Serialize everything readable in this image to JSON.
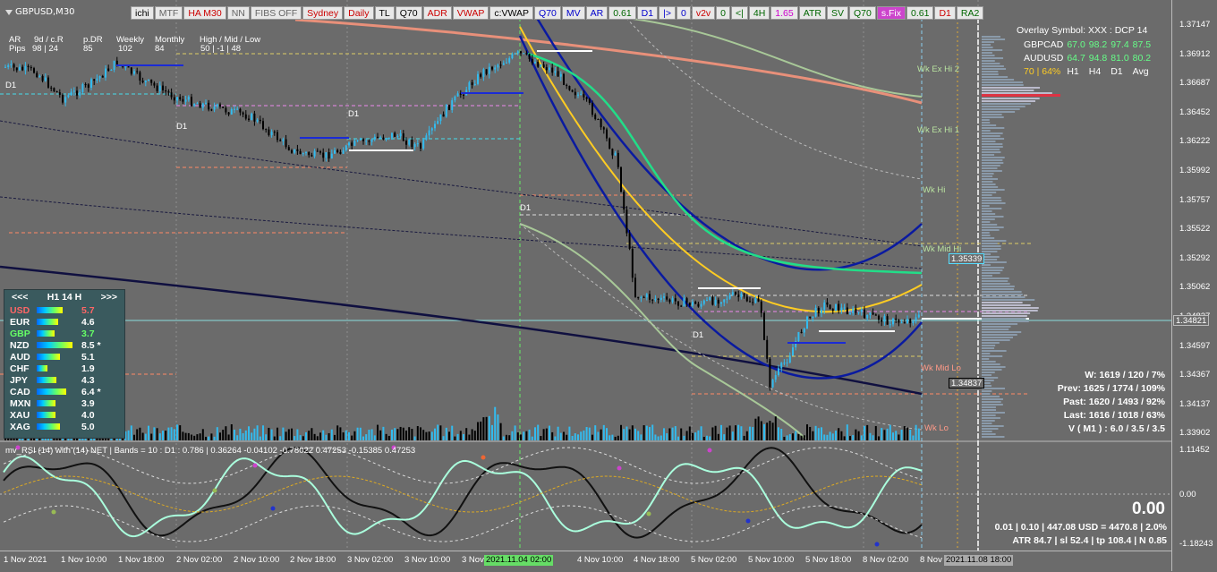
{
  "symbol": "GBPUSD,M30",
  "toolbar": [
    {
      "label": "ichi",
      "color": "#000000"
    },
    {
      "label": "MTF",
      "color": "#666666"
    },
    {
      "label": "HA M30",
      "color": "#cc0000"
    },
    {
      "label": "NN",
      "color": "#666666"
    },
    {
      "label": "FIBS OFF",
      "color": "#666666"
    },
    {
      "label": "Sydney",
      "color": "#cc0000"
    },
    {
      "label": "Daily",
      "color": "#cc0000"
    },
    {
      "label": "TL",
      "color": "#000000"
    },
    {
      "label": "Q70",
      "color": "#000000"
    },
    {
      "label": "ADR",
      "color": "#cc0000"
    },
    {
      "label": "VWAP",
      "color": "#cc0000"
    },
    {
      "label": "c:VWAP",
      "color": "#000000"
    },
    {
      "label": "Q70",
      "color": "#0000cc"
    },
    {
      "label": "MV",
      "color": "#0000cc"
    },
    {
      "label": "AR",
      "color": "#0000cc"
    },
    {
      "label": "0.61",
      "color": "#006600"
    },
    {
      "label": "D1",
      "color": "#0000cc"
    },
    {
      "label": "|>",
      "color": "#0000cc"
    },
    {
      "label": "0",
      "color": "#0000cc"
    },
    {
      "label": "v2v",
      "color": "#cc0000"
    },
    {
      "label": "0",
      "color": "#006600"
    },
    {
      "label": "<|",
      "color": "#006600"
    },
    {
      "label": "4H",
      "color": "#006600"
    },
    {
      "label": "1.65",
      "color": "#cc00cc"
    },
    {
      "label": "ATR",
      "color": "#006600"
    },
    {
      "label": "SV",
      "color": "#006600"
    },
    {
      "label": "Q70",
      "color": "#006600"
    },
    {
      "label": "s.Fix",
      "color": "#ffffff",
      "bg": "#cc44cc"
    },
    {
      "label": "0.61",
      "color": "#006600"
    },
    {
      "label": "D1",
      "color": "#cc0000"
    },
    {
      "label": "RA2",
      "color": "#006600"
    }
  ],
  "stats": {
    "row1": [
      "AR",
      "9d / c.R",
      "p.DR",
      "Weekly",
      "Monthly",
      "High / Mid / Low"
    ],
    "row2_label": "Pips",
    "row2": [
      "98 | 24",
      "85",
      "102",
      "84",
      "50 | -1 | 48"
    ]
  },
  "y_axis": [
    "1.37147",
    "1.36912",
    "1.36687",
    "1.36452",
    "1.36222",
    "1.35992",
    "1.35757",
    "1.35522",
    "1.35292",
    "1.35062",
    "1.34827",
    "1.34597",
    "1.34367",
    "1.34137",
    "1.33902"
  ],
  "current_price": "1.34821",
  "price_tag_1": "1.35339",
  "price_tag_2": "1.34837",
  "x_axis": [
    "1 Nov 2021",
    "1 Nov 10:00",
    "1 Nov 18:00",
    "2 Nov 02:00",
    "2 Nov 10:00",
    "2 Nov 18:00",
    "3 Nov 02:00",
    "3 Nov 10:00",
    "3 Nov",
    "4 Nov 10:00",
    "4 Nov 18:00",
    "5 Nov 02:00",
    "5 Nov 10:00",
    "5 Nov 18:00",
    "8 Nov 02:00",
    "8 Nov"
  ],
  "x_highlight_1": "2021.11.04 02:00",
  "x_highlight_2": "2021.11.08 18:00",
  "strength_panel": {
    "nav_left": "<<<",
    "title": "H1  14  H",
    "nav_right": ">>>",
    "rows": [
      {
        "cur": "USD",
        "val": "5.7",
        "color": "#ff6666",
        "bar": 0.72
      },
      {
        "cur": "EUR",
        "val": "4.6",
        "color": "#ffffff",
        "bar": 0.6
      },
      {
        "cur": "GBP",
        "val": "3.7",
        "color": "#66ff66",
        "bar": 0.5
      },
      {
        "cur": "NZD",
        "val": "8.5 *",
        "color": "#ffffff",
        "bar": 1.0
      },
      {
        "cur": "AUD",
        "val": "5.1",
        "color": "#ffffff",
        "bar": 0.66
      },
      {
        "cur": "CHF",
        "val": "1.9",
        "color": "#ffffff",
        "bar": 0.3
      },
      {
        "cur": "JPY",
        "val": "4.3",
        "color": "#ffffff",
        "bar": 0.56
      },
      {
        "cur": "CAD",
        "val": "6.4 *",
        "color": "#ffffff",
        "bar": 0.82
      },
      {
        "cur": "MXN",
        "val": "3.9",
        "color": "#ffffff",
        "bar": 0.52
      },
      {
        "cur": "XAU",
        "val": "4.0",
        "color": "#ffffff",
        "bar": 0.53
      },
      {
        "cur": "XAG",
        "val": "5.0",
        "color": "#ffffff",
        "bar": 0.64
      }
    ]
  },
  "overlay": {
    "title": "Overlay Symbol: XXX : DCP 14",
    "rows": [
      {
        "sym": "GBPCAD",
        "v": [
          "67.0",
          "98.2",
          "97.4",
          "87.5"
        ]
      },
      {
        "sym": "AUDUSD",
        "v": [
          "64.7",
          "94.8",
          "81.0",
          "80.2"
        ]
      }
    ],
    "footer_pct": "70 | 64%",
    "cols": [
      "H1",
      "H4",
      "D1",
      "Avg"
    ]
  },
  "levels": [
    {
      "label": "Wk Ex Hi 2"
    },
    {
      "label": "Wk Ex Hi 1"
    },
    {
      "label": "Wk Hi"
    },
    {
      "label": "Wk Mid Hi"
    },
    {
      "label": "Wk Mid Lo"
    },
    {
      "label": "Wk Lo"
    }
  ],
  "d1_label": "D1",
  "weekly_stats": [
    "W: 1619 / 120 / 7%",
    "Prev: 1625 / 1774 / 109%",
    "Past: 1620 / 1493 / 92%",
    "Last: 1616 / 1018 / 63%",
    "V ( M1 ) : 6.0 / 3.5 / 3.5"
  ],
  "rsi": {
    "info": "mv_RSI (14) with (14) NET  |  Bands = 10  :  D1 : 0.786  |  0.36264 -0.04102 -0.78022 0.47253 -0.15385 0.47253",
    "y_axis": [
      "1.11452",
      "0.00",
      "-1.18243"
    ],
    "big": "0.00",
    "line1": "0.01  |  0.10  |  447.08 USD = 4470.8  |  2.0%",
    "line2": "ATR 84.7  |  sl 52.4  |  tp 108.4  |  N 0.85"
  }
}
